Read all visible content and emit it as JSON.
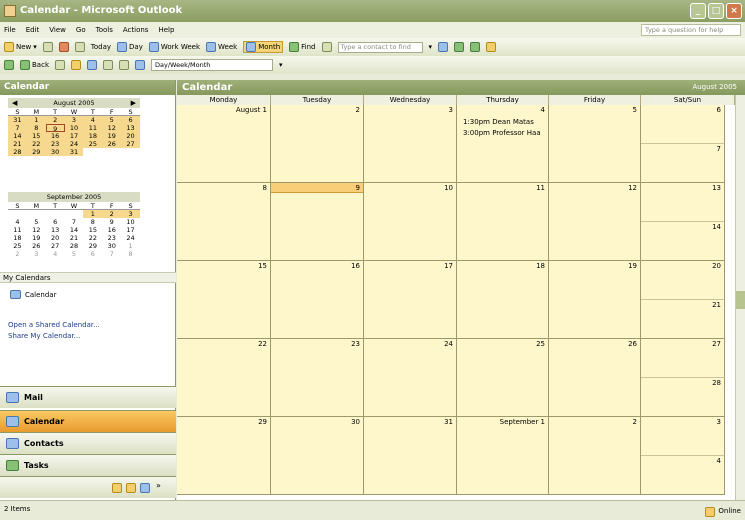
{
  "window": {
    "title": "Calendar - Microsoft Outlook"
  },
  "menu": {
    "items": [
      "File",
      "Edit",
      "View",
      "Go",
      "Tools",
      "Actions",
      "Help"
    ],
    "help_placeholder": "Type a question for help"
  },
  "toolbar1": {
    "new": "New",
    "today": "Today",
    "day": "Day",
    "work_week": "Work Week",
    "week": "Week",
    "month": "Month",
    "find": "Find",
    "contact_placeholder": "Type a contact to find"
  },
  "toolbar2": {
    "back": "Back",
    "view_select": "Day/Week/Month"
  },
  "nav": {
    "header": "Calendar",
    "aug": {
      "title": "August 2005",
      "dow": [
        "S",
        "M",
        "T",
        "W",
        "T",
        "F",
        "S"
      ],
      "days": [
        "31",
        "1",
        "2",
        "3",
        "4",
        "5",
        "6",
        "7",
        "8",
        "9",
        "10",
        "11",
        "12",
        "13",
        "14",
        "15",
        "16",
        "17",
        "18",
        "19",
        "20",
        "21",
        "22",
        "23",
        "24",
        "25",
        "26",
        "27",
        "28",
        "29",
        "30",
        "31"
      ]
    },
    "sep": {
      "title": "September 2005",
      "dow": [
        "S",
        "M",
        "T",
        "W",
        "T",
        "F",
        "S"
      ],
      "days": [
        "",
        "",
        "",
        "",
        "1",
        "2",
        "3",
        "4",
        "5",
        "6",
        "7",
        "8",
        "9",
        "10",
        "11",
        "12",
        "13",
        "14",
        "15",
        "16",
        "17",
        "18",
        "19",
        "20",
        "21",
        "22",
        "23",
        "24",
        "25",
        "26",
        "27",
        "28",
        "29",
        "30",
        "1",
        "2",
        "3",
        "4",
        "5",
        "6",
        "7",
        "8"
      ]
    },
    "my_calendars": "My Calendars",
    "calendar_item": "Calendar",
    "link1": "Open a Shared Calendar...",
    "link2": "Share My Calendar...",
    "buttons": {
      "mail": "Mail",
      "calendar": "Calendar",
      "contacts": "Contacts",
      "tasks": "Tasks"
    }
  },
  "main": {
    "header": "Calendar",
    "range": "August 2005",
    "days": [
      "Monday",
      "Tuesday",
      "Wednesday",
      "Thursday",
      "Friday",
      "Sat/Sun"
    ],
    "weeks": [
      {
        "mon": "August 1",
        "tue": "2",
        "wed": "3",
        "thu": "4",
        "fri": "5",
        "sat": "6",
        "sun": "7"
      },
      {
        "mon": "8",
        "tue": "9",
        "wed": "10",
        "thu": "11",
        "fri": "12",
        "sat": "13",
        "sun": "14"
      },
      {
        "mon": "15",
        "tue": "16",
        "wed": "17",
        "thu": "18",
        "fri": "19",
        "sat": "20",
        "sun": "21"
      },
      {
        "mon": "22",
        "tue": "23",
        "wed": "24",
        "thu": "25",
        "fri": "26",
        "sat": "27",
        "sun": "28"
      },
      {
        "mon": "29",
        "tue": "30",
        "wed": "31",
        "thu": "September 1",
        "fri": "2",
        "sat": "3",
        "sun": "4"
      }
    ],
    "appt1": "1:30pm  Dean Matas",
    "appt2": "3:00pm  Professor Haa"
  },
  "status": {
    "items": "2 Items",
    "online": "Online"
  }
}
